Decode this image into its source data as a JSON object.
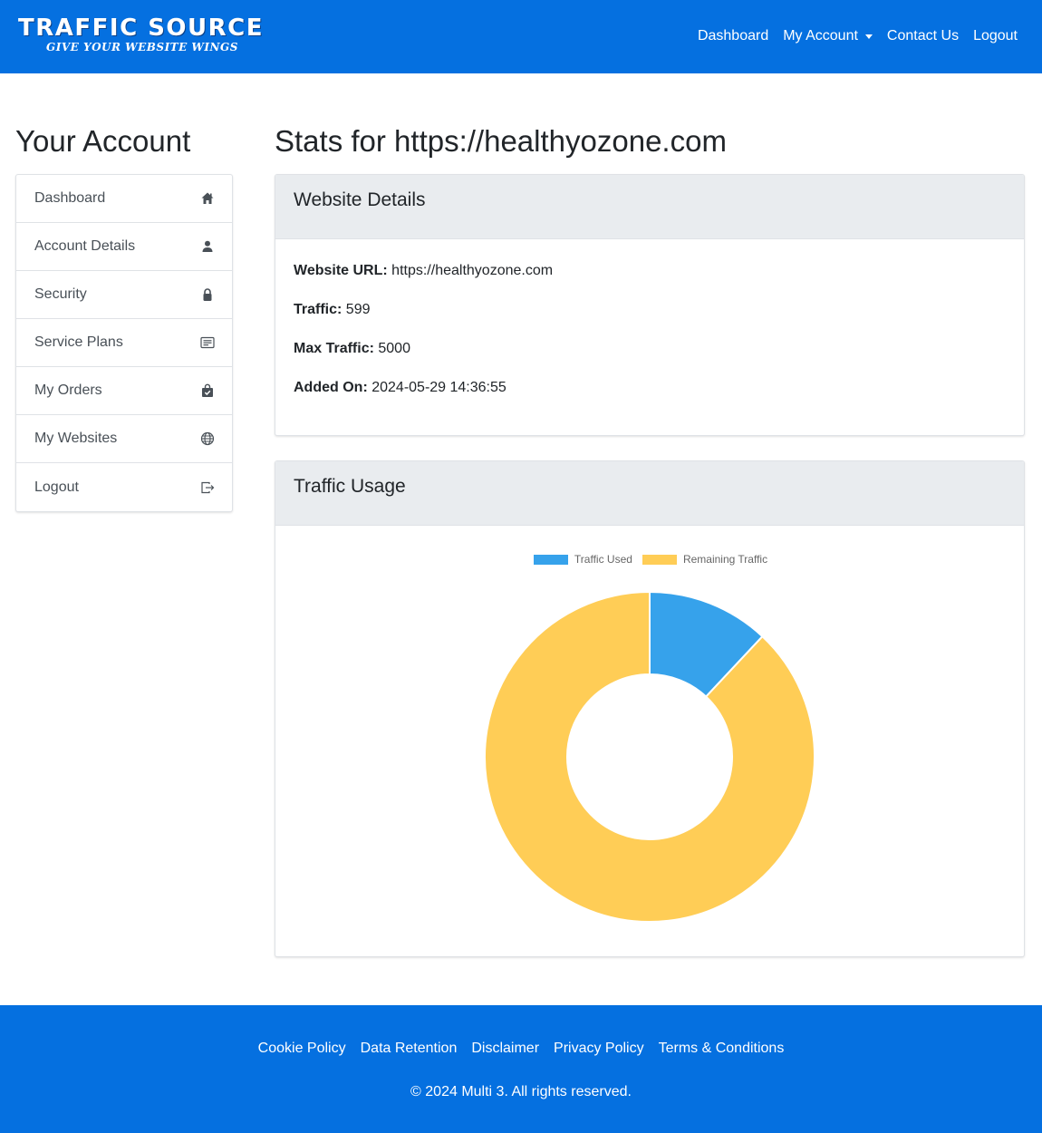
{
  "header": {
    "brand_title": "TRAFFIC SOURCE",
    "brand_tagline": "GIVE YOUR WEBSITE WINGS",
    "nav": {
      "dashboard": "Dashboard",
      "my_account": "My Account",
      "contact_us": "Contact Us",
      "logout": "Logout"
    }
  },
  "sidebar": {
    "title": "Your Account",
    "items": [
      {
        "label": "Dashboard",
        "icon": "home-icon"
      },
      {
        "label": "Account Details",
        "icon": "user-icon"
      },
      {
        "label": "Security",
        "icon": "lock-icon"
      },
      {
        "label": "Service Plans",
        "icon": "list-card-icon"
      },
      {
        "label": "My Orders",
        "icon": "shopping-bag-check-icon"
      },
      {
        "label": "My Websites",
        "icon": "globe-icon"
      },
      {
        "label": "Logout",
        "icon": "logout-icon"
      }
    ]
  },
  "main": {
    "title": "Stats for https://healthyozone.com",
    "details_card": {
      "header": "Website Details",
      "rows": [
        {
          "label": "Website URL:",
          "value": "https://healthyozone.com"
        },
        {
          "label": "Traffic:",
          "value": "599"
        },
        {
          "label": "Max Traffic:",
          "value": "5000"
        },
        {
          "label": "Added On:",
          "value": "2024-05-29 14:36:55"
        }
      ]
    },
    "usage_card": {
      "header": "Traffic Usage"
    }
  },
  "chart_data": {
    "type": "pie",
    "variant": "doughnut",
    "labels": [
      "Traffic Used",
      "Remaining Traffic"
    ],
    "values": [
      599,
      4401
    ],
    "colors": [
      "#36a2eb",
      "#ffcd56"
    ],
    "legend": "top-center"
  },
  "footer": {
    "links": [
      "Cookie Policy",
      "Data Retention",
      "Disclaimer",
      "Privacy Policy",
      "Terms & Conditions"
    ],
    "copyright": "© 2024 Multi 3. All rights reserved."
  },
  "colors": {
    "brand_blue": "#0570e0",
    "card_header_bg": "#e9ecef"
  }
}
